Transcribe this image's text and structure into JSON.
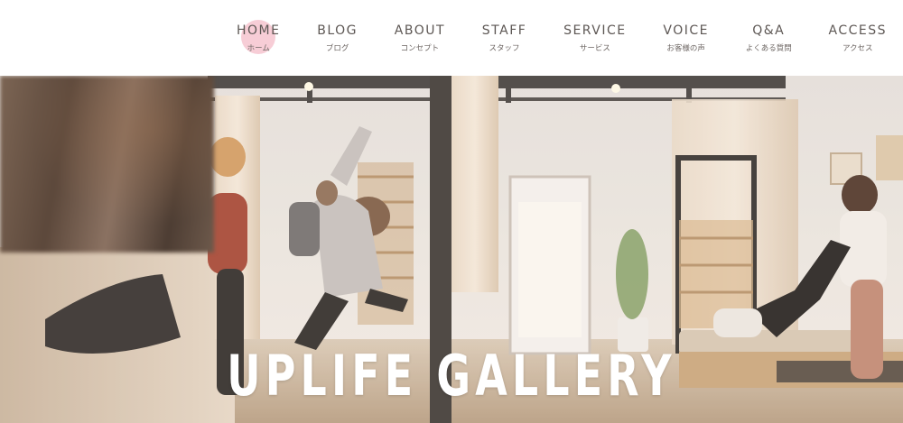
{
  "nav": {
    "items": [
      {
        "en": "HOME",
        "ja": "ホーム",
        "active": true
      },
      {
        "en": "BLOG",
        "ja": "ブログ",
        "active": false
      },
      {
        "en": "ABOUT",
        "ja": "コンセプト",
        "active": false
      },
      {
        "en": "STAFF",
        "ja": "スタッフ",
        "active": false
      },
      {
        "en": "SERVICE",
        "ja": "サービス",
        "active": false
      },
      {
        "en": "VOICE",
        "ja": "お客様の声",
        "active": false
      },
      {
        "en": "Q&A",
        "ja": "よくある質問",
        "active": false
      },
      {
        "en": "ACCESS",
        "ja": "アクセス",
        "active": false
      }
    ]
  },
  "hero": {
    "title": "UPLIFE GALLERY"
  },
  "colors": {
    "nav_text": "#5d5754",
    "active_dot": "#f6c8d2",
    "title": "#ffffff"
  }
}
